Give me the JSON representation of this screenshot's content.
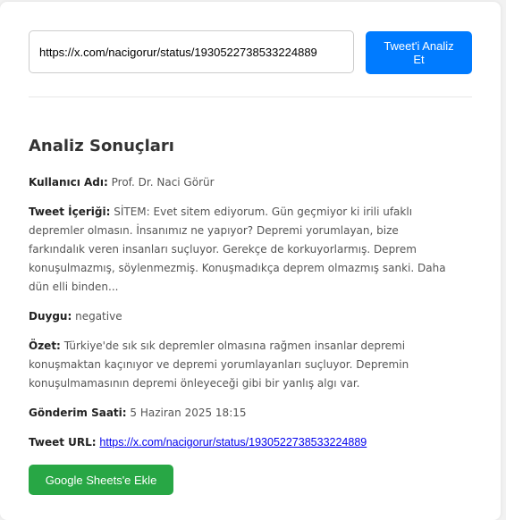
{
  "form": {
    "url_value": "https://x.com/nacigorur/status/1930522738533224889",
    "analyze_label": "Tweet'i Analiz Et"
  },
  "results": {
    "title": "Analiz Sonuçları",
    "username_label": "Kullanıcı Adı:",
    "username_value": "Prof. Dr. Naci Görür",
    "content_label": "Tweet İçeriği:",
    "content_value": "SİTEM: Evet sitem ediyorum. Gün geçmiyor ki irili ufaklı depremler olmasın. İnsanımız ne yapıyor? Depremi yorumlayan, bize farkındalık veren insanları suçluyor. Gerekçe de korkuyorlarmış. Deprem konuşulmazmış, söylenmezmiş. Konuşmadıkça deprem olmazmış sanki. Daha dün elli binden...",
    "sentiment_label": "Duygu:",
    "sentiment_value": "negative",
    "summary_label": "Özet:",
    "summary_value": "Türkiye'de sık sık depremler olmasına rağmen insanlar depremi konuşmaktan kaçınıyor ve depremi yorumlayanları suçluyor. Depremin konuşulmamasının depremi önleyeceği gibi bir yanlış algı var.",
    "time_label": "Gönderim Saati:",
    "time_value": "5 Haziran 2025 18:15",
    "url_label": "Tweet URL:",
    "url_value": "https://x.com/nacigorur/status/1930522738533224889",
    "sheets_label": "Google Sheets'e Ekle"
  },
  "colors": {
    "primary": "#007bff",
    "success": "#28a745",
    "link": "#0000ee"
  }
}
